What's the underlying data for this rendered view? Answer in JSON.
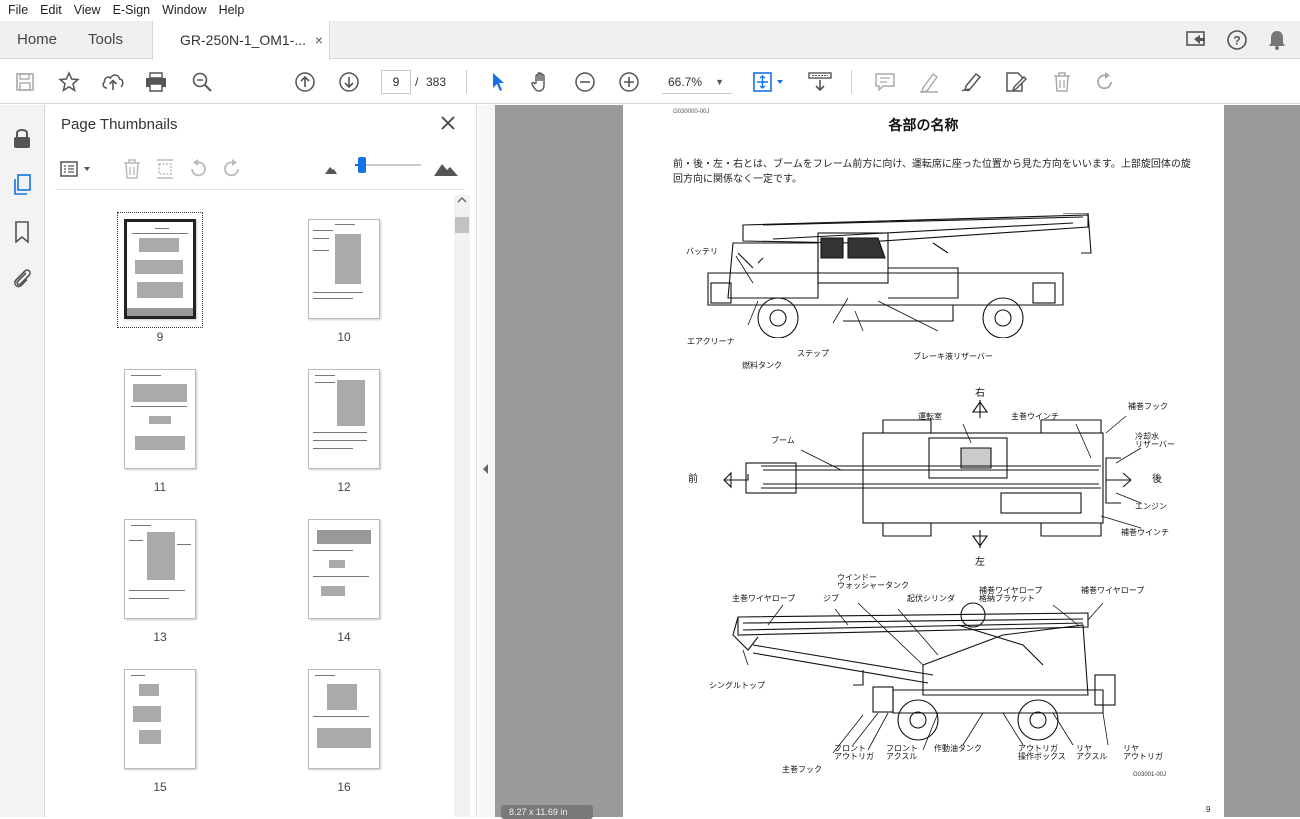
{
  "menu": [
    "File",
    "Edit",
    "View",
    "E-Sign",
    "Window",
    "Help"
  ],
  "tabs": {
    "home": "Home",
    "tools": "Tools",
    "doc": "GR-250N-1_OM1-...",
    "close": "×"
  },
  "toolbar": {
    "page_current": "9",
    "page_sep": "/",
    "page_total": "383",
    "zoom": "66.7%",
    "zoom_caret": "▼"
  },
  "panel": {
    "title": "Page Thumbnails",
    "close": "✕"
  },
  "thumbnails": [
    "9",
    "10",
    "11",
    "12",
    "13",
    "14",
    "15",
    "16"
  ],
  "document": {
    "code": "G030000-00J",
    "title": "各部の名称",
    "intro": "前・後・左・右とは、ブームをフレーム前方に向け、運転席に座った位置から見た方向をいいます。上部旋回体の旋回方向に関係なく一定です。",
    "fig1": {
      "battery": "バッテリ",
      "air_cleaner": "エアクリーナ",
      "fuel_tank": "燃料タンク",
      "step": "ステップ",
      "brake_reservoir": "ブレーキ液リザーバー"
    },
    "fig2": {
      "right": "右",
      "left": "左",
      "front": "前",
      "rear": "後",
      "cab": "運転室",
      "main_winch": "主巻ウインチ",
      "aux_hook": "補巻フック",
      "boom": "ブーム",
      "coolant_1": "冷却水",
      "coolant_2": "リザーバー",
      "engine": "エンジン",
      "aux_winch": "補巻ウインチ"
    },
    "fig3": {
      "washer_1": "ウインドー",
      "washer_2": "ウォッシャータンク",
      "main_rope": "主巻ワイヤロープ",
      "jib": "ジブ",
      "derrick": "起伏シリンダ",
      "aux_bracket_1": "補巻ワイヤロープ",
      "aux_bracket_2": "格納ブラケット",
      "aux_rope": "補巻ワイヤロープ",
      "single_top": "シングルトップ",
      "front_out_1": "フロント",
      "front_out_2": "アウトリガ",
      "front_axle_1": "フロント",
      "front_axle_2": "アクスル",
      "hyd_tank": "作動油タンク",
      "out_box_1": "アウトリガ",
      "out_box_2": "操作ボックス",
      "rear_axle_1": "リヤ",
      "rear_axle_2": "アクスル",
      "rear_out_1": "リヤ",
      "rear_out_2": "アウトリガ",
      "main_hook": "主巻フック"
    },
    "fig_code": "G03001-00J",
    "page_num": "9"
  },
  "size_badge": "8.27 x 11.69 in"
}
